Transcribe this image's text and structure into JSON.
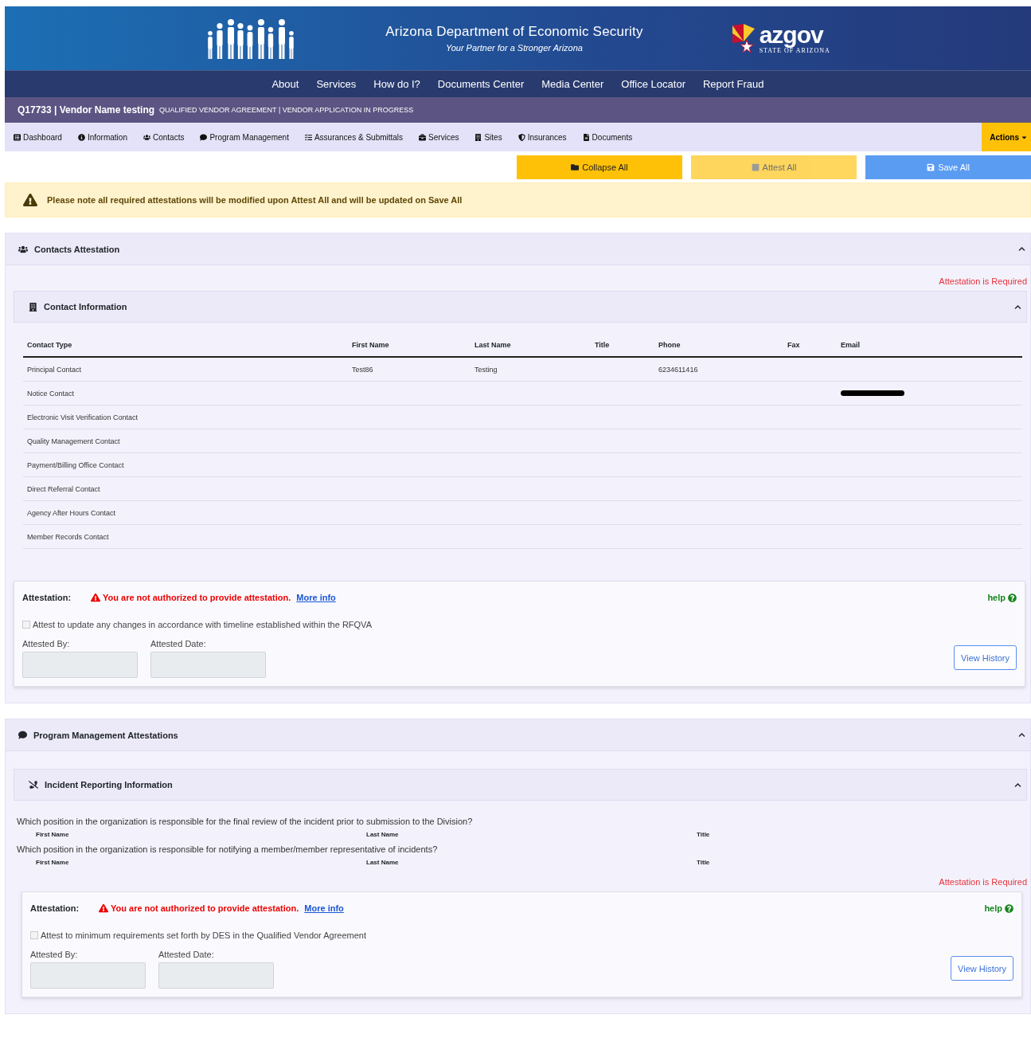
{
  "header": {
    "title": "Arizona Department of Economic Security",
    "subtitle": "Your Partner for a Stronger Arizona",
    "logo_text": "azgov",
    "logo_sub": "STATE OF ARIZONA"
  },
  "nav": [
    "About",
    "Services",
    "How do I?",
    "Documents Center",
    "Media Center",
    "Office Locator",
    "Report Fraud"
  ],
  "vendor_bar": {
    "name": "Q17733 | Vendor Name testing",
    "detail": "QUALIFIED VENDOR AGREEMENT | VENDOR APPLICATION IN PROGRESS"
  },
  "tabs": [
    "Dashboard",
    "Information",
    "Contacts",
    "Program Management",
    "Assurances & Submittals",
    "Services",
    "Sites",
    "Insurances",
    "Documents"
  ],
  "actions_button": "Actions",
  "toolbar": [
    {
      "label": "Collapse All",
      "kind": "collapse",
      "disabled": false
    },
    {
      "label": "Attest All",
      "kind": "attest",
      "disabled": true
    },
    {
      "label": "Save All",
      "kind": "save",
      "disabled": false
    }
  ],
  "alert": "Please note all required attestations will be modified upon Attest All and will be updated on Save All",
  "contacts_section": {
    "title": "Contacts Attestation",
    "expanded": true,
    "required_note": "Attestation is Required",
    "subsection": {
      "title": "Contact Information",
      "expanded": true
    },
    "columns": [
      "Contact Type",
      "First Name",
      "Last Name",
      "Title",
      "Phone",
      "Fax",
      "Email"
    ],
    "rows": [
      {
        "cells": [
          "Principal Contact",
          "Test86",
          "Testing",
          "",
          "6234611416",
          "",
          ""
        ],
        "redacted": false
      },
      {
        "cells": [
          "Notice Contact",
          "",
          "",
          "",
          "",
          "",
          ""
        ],
        "redacted": true
      },
      {
        "cells": [
          "Electronic Visit Verification Contact",
          "",
          "",
          "",
          "",
          "",
          ""
        ],
        "redacted": false
      },
      {
        "cells": [
          "Quality Management Contact",
          "",
          "",
          "",
          "",
          "",
          ""
        ],
        "redacted": false
      },
      {
        "cells": [
          "Payment/Billing Office Contact",
          "",
          "",
          "",
          "",
          "",
          ""
        ],
        "redacted": false
      },
      {
        "cells": [
          "Direct Referral Contact",
          "",
          "",
          "",
          "",
          "",
          ""
        ],
        "redacted": false
      },
      {
        "cells": [
          "Agency After Hours Contact",
          "",
          "",
          "",
          "",
          "",
          ""
        ],
        "redacted": false
      },
      {
        "cells": [
          "Member Records Contact",
          "",
          "",
          "",
          "",
          "",
          ""
        ],
        "redacted": false
      }
    ],
    "attestation": {
      "label": "Attestation:",
      "warning": "You are not authorized to provide attestation.",
      "link": "More info",
      "help": "help",
      "checkbox_label": "Attest to update any changes in accordance with timeline established within the RFQVA",
      "checked": false,
      "attested_by": "Attested By:",
      "attested_date": "Attested Date:",
      "history_button": "View History"
    }
  },
  "program_section": {
    "title": "Program Management Attestations",
    "expanded": true,
    "subsection": {
      "title": "Incident Reporting Information",
      "expanded": true
    },
    "questions": [
      {
        "text": "Which position in the organization is responsible for the final review of the incident prior to submission to the Division?",
        "columns": [
          "First Name",
          "Last Name",
          "Title"
        ]
      },
      {
        "text": "Which position in the organization is responsible for notifying a member/member representative of incidents?",
        "columns": [
          "First Name",
          "Last Name",
          "Title"
        ]
      }
    ],
    "required_note": "Attestation is Required",
    "attestation": {
      "label": "Attestation:",
      "warning": "You are not authorized to provide attestation.",
      "link": "More info",
      "help": "help",
      "checkbox_label": "Attest to minimum requirements set forth by DES in the Qualified Vendor Agreement",
      "checked": false,
      "attested_by": "Attested By:",
      "attested_date": "Attested Date:",
      "history_button": "View History"
    }
  }
}
